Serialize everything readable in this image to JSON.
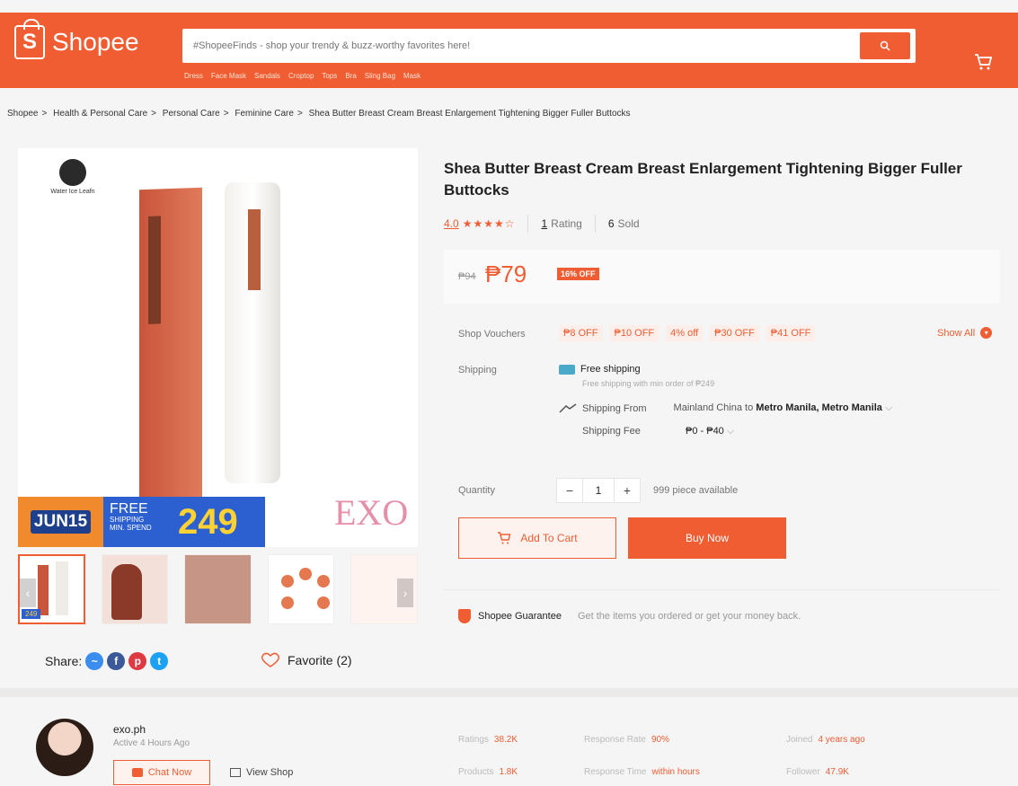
{
  "header": {
    "logo_text": "Shopee",
    "logo_mark": "S",
    "search_placeholder": "#ShopeeFinds - shop your trendy & buzz-worthy favorites here!",
    "hints": [
      "Dress",
      "Face Mask",
      "Sandals",
      "Croptop",
      "Tops",
      "Bra",
      "Sling Bag",
      "Mask"
    ]
  },
  "breadcrumb": [
    "Shopee",
    "Health & Personal Care",
    "Personal Care",
    "Feminine Care",
    "Shea Butter Breast Cream Breast Enlargement Tightening Bigger Fuller Buttocks"
  ],
  "gallery": {
    "brand_name": "Water Ice Leafn",
    "banner_date": "JUN15",
    "banner_free": "FREE",
    "banner_shipping": "SHIPPING",
    "banner_spend": "MIN. SPEND",
    "banner_amount": "249",
    "watermark": "EXO",
    "thumb_badge": "249",
    "share_label": "Share:",
    "favorite_label": "Favorite (2)"
  },
  "product": {
    "title": "Shea Butter Breast Cream Breast Enlargement Tightening Bigger Fuller Buttocks",
    "rating": "4.0",
    "stars": "★★★★☆",
    "rating_value": 4.0,
    "rating_count": "1",
    "rating_label": "Rating",
    "sold_count": "6",
    "sold_label": "Sold",
    "old_price": "₱94",
    "price": "₱79",
    "discount": "16% OFF"
  },
  "vouchers": {
    "label": "Shop Vouchers",
    "items": [
      "₱8 OFF",
      "₱10 OFF",
      "4% off",
      "₱30 OFF",
      "₱41 OFF"
    ],
    "show_all": "Show All"
  },
  "shipping": {
    "label": "Shipping",
    "free_title": "Free shipping",
    "free_sub": "Free shipping with min order of ₱249",
    "from_label": "Shipping From",
    "from_value": "Mainland China",
    "to_word": "to",
    "to_value": "Metro Manila, Metro Manila",
    "fee_label": "Shipping Fee",
    "fee_value": "₱0 - ₱40"
  },
  "quantity": {
    "label": "Quantity",
    "minus": "−",
    "value": "1",
    "plus": "+",
    "available": "999 piece available"
  },
  "actions": {
    "add_to_cart": "Add To Cart",
    "buy_now": "Buy Now"
  },
  "guarantee": {
    "title": "Shopee Guarantee",
    "desc": "Get the items you ordered or get your money back."
  },
  "seller": {
    "name": "exo.ph",
    "active": "Active 4 Hours Ago",
    "chat": "Chat Now",
    "view_shop": "View Shop",
    "stats": {
      "ratings_label": "Ratings",
      "ratings_value": "38.2K",
      "products_label": "Products",
      "products_value": "1.8K",
      "response_rate_label": "Response Rate",
      "response_rate_value": "90%",
      "response_time_label": "Response Time",
      "response_time_value": "within hours",
      "joined_label": "Joined",
      "joined_value": "4 years ago",
      "follower_label": "Follower",
      "follower_value": "47.9K"
    }
  },
  "colors": {
    "brand": "#f05d32",
    "banner_blue": "#2c5fd0",
    "banner_yellow": "#ffd233"
  }
}
